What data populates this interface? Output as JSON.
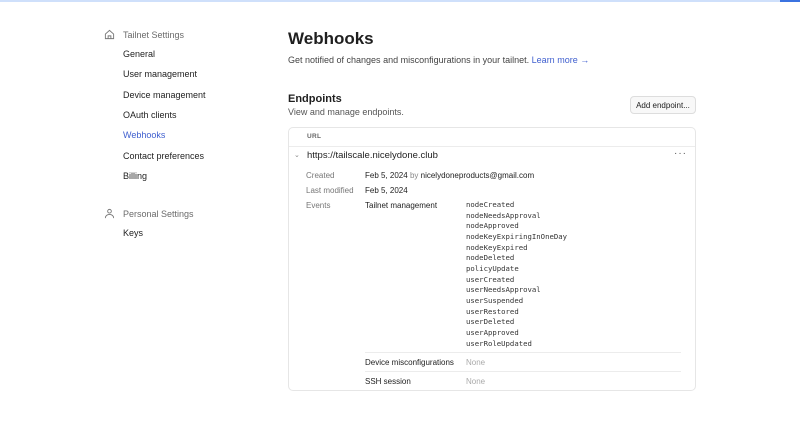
{
  "sidebar": {
    "tailnet_heading": "Tailnet Settings",
    "items": [
      "General",
      "User management",
      "Device management",
      "OAuth clients",
      "Webhooks",
      "Contact preferences",
      "Billing"
    ],
    "personal_heading": "Personal Settings",
    "personal_items": [
      "Keys"
    ]
  },
  "page": {
    "title": "Webhooks",
    "subtitle": "Get notified of changes and misconfigurations in your tailnet.",
    "learn_more": "Learn more →"
  },
  "endpoints": {
    "heading": "Endpoints",
    "subheading": "View and manage endpoints.",
    "add_button": "Add endpoint...",
    "column_url": "URL",
    "endpoint": {
      "url": "https://tailscale.nicelydone.club",
      "more": "···",
      "created_label": "Created",
      "created": "Feb 5, 2024",
      "by": "by",
      "created_by": "nicelydoneproducts@gmail.com",
      "modified_label": "Last modified",
      "modified": "Feb 5, 2024",
      "events_label": "Events",
      "groups": [
        {
          "name": "Tailnet management",
          "events": [
            "nodeCreated",
            "nodeNeedsApproval",
            "nodeApproved",
            "nodeKeyExpiringInOneDay",
            "nodeKeyExpired",
            "nodeDeleted",
            "policyUpdate",
            "userCreated",
            "userNeedsApproval",
            "userSuspended",
            "userRestored",
            "userDeleted",
            "userApproved",
            "userRoleUpdated"
          ]
        },
        {
          "name": "Device misconfigurations",
          "value": "None"
        },
        {
          "name": "SSH session",
          "value": "None"
        }
      ]
    }
  }
}
